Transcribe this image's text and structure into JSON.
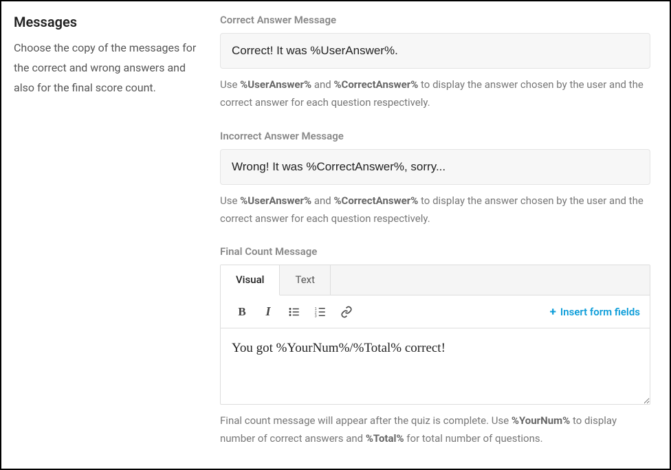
{
  "sidebar": {
    "title": "Messages",
    "description": "Choose the copy of the messages for the correct and wrong answers and also for the final score count."
  },
  "correct": {
    "label": "Correct Answer Message",
    "value": "Correct! It was %UserAnswer%.",
    "hint_pre": "Use ",
    "hint_var1": "%UserAnswer%",
    "hint_mid": " and ",
    "hint_var2": "%CorrectAnswer%",
    "hint_post": " to display the answer chosen by the user and the correct answer for each question respectively."
  },
  "incorrect": {
    "label": "Incorrect Answer Message",
    "value": "Wrong! It was %CorrectAnswer%, sorry...",
    "hint_pre": "Use ",
    "hint_var1": "%UserAnswer%",
    "hint_mid": " and ",
    "hint_var2": "%CorrectAnswer%",
    "hint_post": " to display the answer chosen by the user and the correct answer for each question respectively."
  },
  "final": {
    "label": "Final Count Message",
    "tabs": {
      "visual": "Visual",
      "text": "Text"
    },
    "toolbar": {
      "bold": "B",
      "italic": "I",
      "insert": "Insert form fields"
    },
    "body": "You got %YourNum%/%Total% correct!",
    "hint_pre": "Final count message will appear after the quiz is complete. Use ",
    "hint_var1": "%YourNum%",
    "hint_mid": " to display number of correct answers and ",
    "hint_var2": "%Total%",
    "hint_post": " for total number of questions."
  }
}
